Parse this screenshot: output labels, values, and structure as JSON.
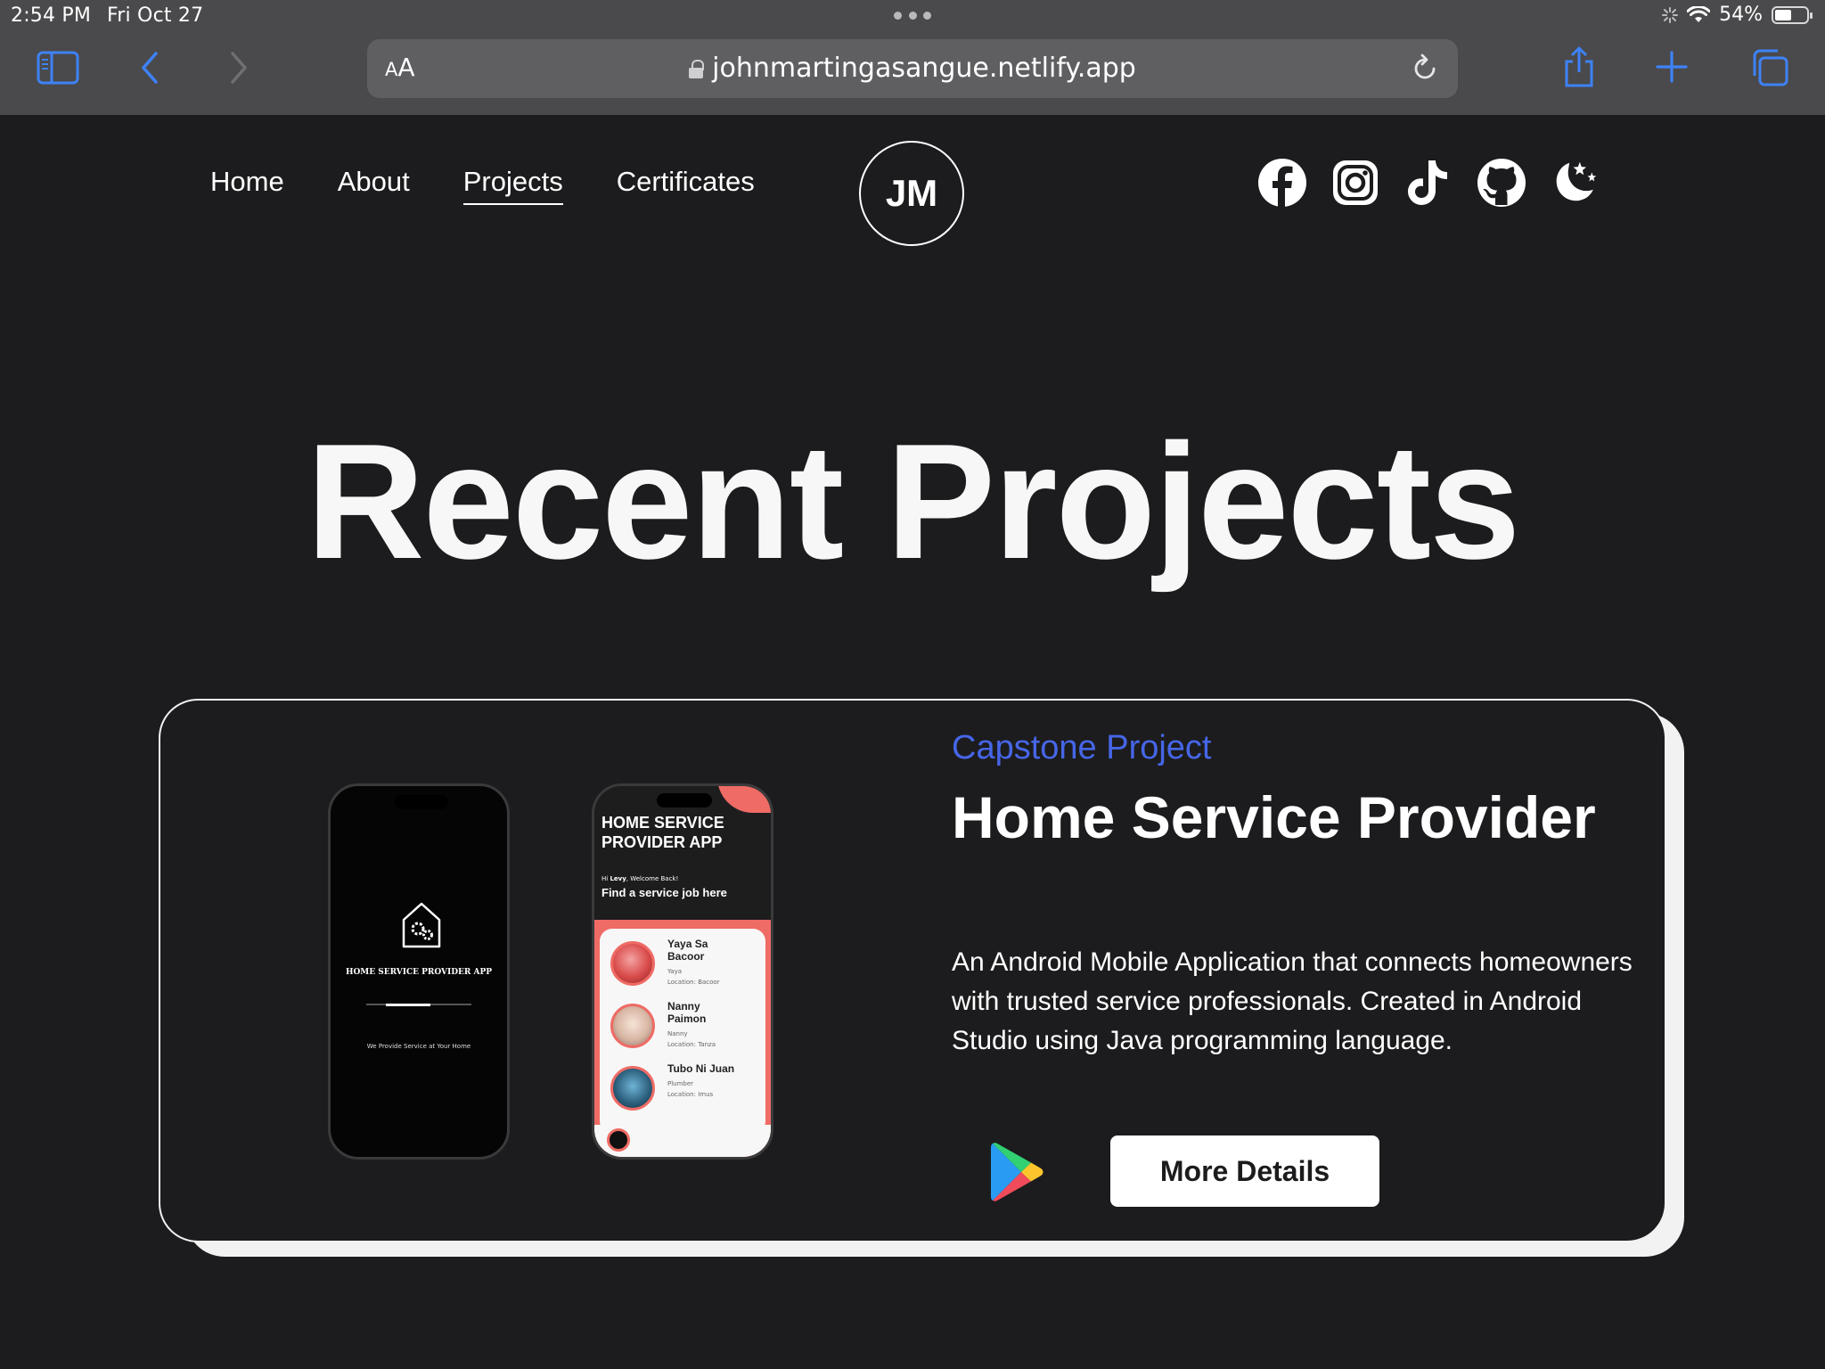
{
  "status_bar": {
    "time": "2:54 PM",
    "date": "Fri Oct 27",
    "battery_percent": "54%",
    "battery_level": 0.54
  },
  "browser": {
    "aa_label_small": "A",
    "aa_label_large": "A",
    "url": "johnmartingasangue.netlify.app",
    "icons": [
      "sidebar-icon",
      "back-icon",
      "forward-icon",
      "lock-icon",
      "reload-icon",
      "share-icon",
      "new-tab-icon",
      "tabs-icon"
    ]
  },
  "site": {
    "nav": [
      {
        "label": "Home",
        "active": false
      },
      {
        "label": "About",
        "active": false
      },
      {
        "label": "Projects",
        "active": true
      },
      {
        "label": "Certificates",
        "active": false
      }
    ],
    "logo": "JM",
    "social_icons": [
      "facebook-icon",
      "instagram-icon",
      "tiktok-icon",
      "github-icon",
      "dark-mode-icon"
    ]
  },
  "hero": {
    "title": "Recent Projects"
  },
  "project": {
    "kicker": "Capstone Project",
    "title": "Home Service Provider",
    "description": "An Android Mobile Application that connects homeowners with trusted service professionals. Created in Android Studio using Java programming language.",
    "button_label": "More Details",
    "store_icon": "google-play-icon",
    "colors": {
      "kicker": "#4666e8",
      "app_accent": "#ef6b65"
    },
    "splash_screen": {
      "title": "HOME SERVICE PROVIDER APP",
      "tagline": "We Provide Service at Your Home"
    },
    "app_screen": {
      "heading": "HOME SERVICE\nPROVIDER APP",
      "greeting_pre": "Hi ",
      "greeting_name": "Levy",
      "greeting_post": ", Welcome Back!",
      "subheading": "Find a service job here",
      "providers": [
        {
          "name": "Yaya Sa\nBacoor",
          "role": "Yaya",
          "location": "Location: Bacoor"
        },
        {
          "name": "Nanny\nPaimon",
          "role": "Nanny",
          "location": "Location: Tanza"
        },
        {
          "name": "Tubo Ni Juan",
          "role": "Plumber",
          "location": "Location: Imus"
        }
      ]
    }
  }
}
